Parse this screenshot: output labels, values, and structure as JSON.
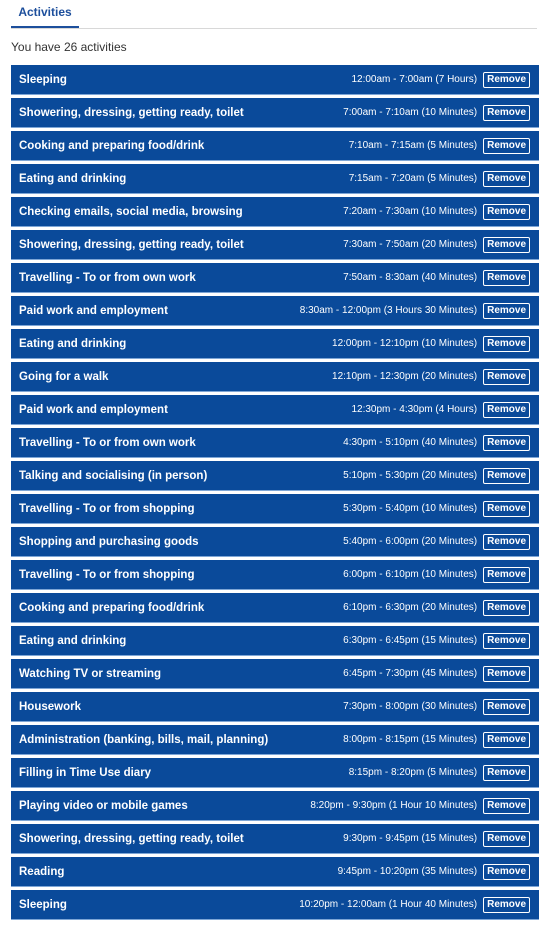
{
  "tabs": [
    {
      "label": "Activities",
      "active": true
    }
  ],
  "summary": "You have 26 activities",
  "colors": {
    "accent": "#1d4f9c",
    "row_bg": "#0a4a9a",
    "text_on_row": "#ffffff"
  },
  "remove_label": "Remove",
  "activities": [
    {
      "name": "Sleeping",
      "time": "12:00am - 7:00am (7 Hours)"
    },
    {
      "name": "Showering, dressing, getting ready, toilet",
      "time": "7:00am - 7:10am (10 Minutes)"
    },
    {
      "name": "Cooking and preparing food/drink",
      "time": "7:10am - 7:15am (5 Minutes)"
    },
    {
      "name": "Eating and drinking",
      "time": "7:15am - 7:20am (5 Minutes)"
    },
    {
      "name": "Checking emails, social media, browsing",
      "time": "7:20am - 7:30am (10 Minutes)"
    },
    {
      "name": "Showering, dressing, getting ready, toilet",
      "time": "7:30am - 7:50am (20 Minutes)"
    },
    {
      "name": "Travelling - To or from own work",
      "time": "7:50am - 8:30am (40 Minutes)"
    },
    {
      "name": "Paid work and employment",
      "time": "8:30am - 12:00pm (3 Hours 30 Minutes)"
    },
    {
      "name": "Eating and drinking",
      "time": "12:00pm - 12:10pm (10 Minutes)"
    },
    {
      "name": "Going for a walk",
      "time": "12:10pm - 12:30pm (20 Minutes)"
    },
    {
      "name": "Paid work and employment",
      "time": "12:30pm - 4:30pm (4 Hours)"
    },
    {
      "name": "Travelling - To or from own work",
      "time": "4:30pm - 5:10pm (40 Minutes)"
    },
    {
      "name": "Talking and socialising (in person)",
      "time": "5:10pm - 5:30pm (20 Minutes)"
    },
    {
      "name": "Travelling - To or from shopping",
      "time": "5:30pm - 5:40pm (10 Minutes)"
    },
    {
      "name": "Shopping and purchasing goods",
      "time": "5:40pm - 6:00pm (20 Minutes)"
    },
    {
      "name": "Travelling - To or from shopping",
      "time": "6:00pm - 6:10pm (10 Minutes)"
    },
    {
      "name": "Cooking and preparing food/drink",
      "time": "6:10pm - 6:30pm (20 Minutes)"
    },
    {
      "name": "Eating and drinking",
      "time": "6:30pm - 6:45pm (15 Minutes)"
    },
    {
      "name": "Watching TV or streaming",
      "time": "6:45pm - 7:30pm (45 Minutes)"
    },
    {
      "name": "Housework",
      "time": "7:30pm - 8:00pm (30 Minutes)"
    },
    {
      "name": "Administration (banking, bills, mail, planning)",
      "time": "8:00pm - 8:15pm (15 Minutes)"
    },
    {
      "name": "Filling in Time Use diary",
      "time": "8:15pm - 8:20pm (5 Minutes)"
    },
    {
      "name": "Playing video or mobile games",
      "time": "8:20pm - 9:30pm (1 Hour 10 Minutes)"
    },
    {
      "name": "Showering, dressing, getting ready, toilet",
      "time": "9:30pm - 9:45pm (15 Minutes)"
    },
    {
      "name": "Reading",
      "time": "9:45pm - 10:20pm (35 Minutes)"
    },
    {
      "name": "Sleeping",
      "time": "10:20pm - 12:00am (1 Hour 40 Minutes)"
    }
  ]
}
